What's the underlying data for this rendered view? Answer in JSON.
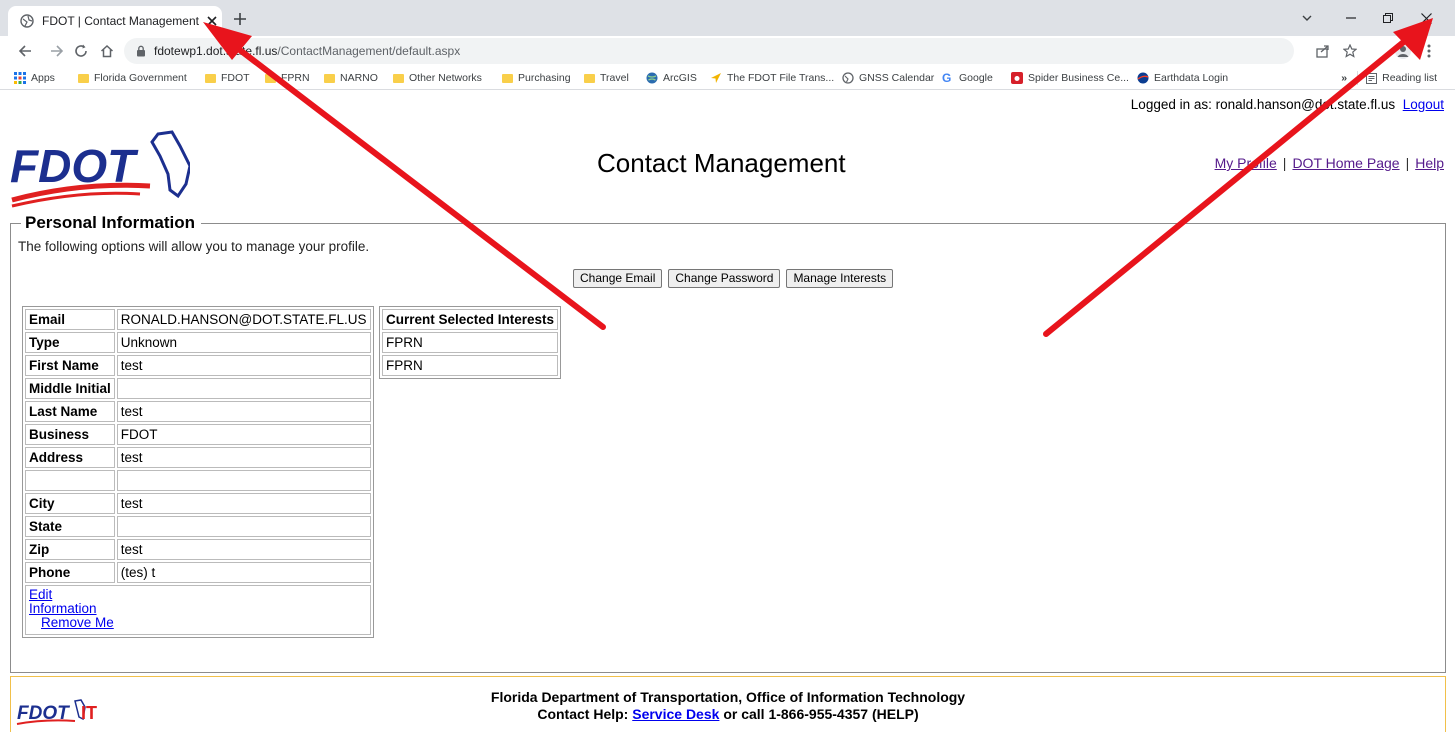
{
  "browser": {
    "tab_title": "FDOT | Contact Management | Ho",
    "url_host": "fdotewp1.dot.state.fl.us",
    "url_path": "/ContactManagement/default.aspx",
    "bookmarks": [
      {
        "label": "Apps",
        "icon": "apps-grid-icon"
      },
      {
        "label": "Florida Government",
        "icon": "folder-icon"
      },
      {
        "label": "FDOT",
        "icon": "folder-icon"
      },
      {
        "label": "FPRN",
        "icon": "folder-icon"
      },
      {
        "label": "NARNO",
        "icon": "folder-icon"
      },
      {
        "label": "Other Networks",
        "icon": "folder-icon"
      },
      {
        "label": "Purchasing",
        "icon": "folder-icon"
      },
      {
        "label": "Travel",
        "icon": "folder-icon"
      },
      {
        "label": "ArcGIS",
        "icon": "globe-icon"
      },
      {
        "label": "The FDOT File Trans...",
        "icon": "send-icon"
      },
      {
        "label": "GNSS Calendar",
        "icon": "globe-icon"
      },
      {
        "label": "Google",
        "icon": "google-icon"
      },
      {
        "label": "Spider Business Ce...",
        "icon": "spider-icon"
      },
      {
        "label": "Earthdata Login",
        "icon": "nasa-icon"
      }
    ],
    "reading_list": "Reading list"
  },
  "header": {
    "logged_in_text": "Logged in as: ronald.hanson@dot.state.fl.us",
    "logout": "Logout",
    "title": "Contact Management",
    "links": {
      "my_profile": "My Profile",
      "dot_home": "DOT Home Page",
      "help": "Help"
    },
    "separator": "|"
  },
  "personal": {
    "legend": "Personal Information",
    "intro": "The following options will allow you to manage your profile.",
    "buttons": {
      "change_email": "Change Email",
      "change_password": "Change Password",
      "manage_interests": "Manage Interests"
    },
    "labels": {
      "email": "Email",
      "type": "Type",
      "first_name": "First Name",
      "middle_initial": "Middle Initial",
      "last_name": "Last Name",
      "business": "Business",
      "address": "Address",
      "city": "City",
      "state": "State",
      "zip": "Zip",
      "phone": "Phone"
    },
    "values": {
      "email": "RONALD.HANSON@DOT.STATE.FL.US",
      "type": "Unknown",
      "first_name": "test",
      "middle_initial": "",
      "last_name": "test",
      "business": "FDOT",
      "address": "test",
      "address2": "",
      "city": "test",
      "state": "",
      "zip": "test",
      "phone": "(tes) t"
    },
    "edit_link_1": "Edit",
    "edit_link_2": "Information",
    "remove_link": "Remove Me"
  },
  "interests": {
    "header": "Current Selected Interests",
    "items": [
      "FPRN",
      "FPRN"
    ]
  },
  "footer": {
    "line1": "Florida Department of Transportation, Office of Information Technology",
    "line2_prefix": "Contact Help:",
    "service_desk": "Service Desk",
    "line2_suffix": "or call 1-866-955-4357 (HELP)"
  },
  "colors": {
    "fdot_blue": "#1c2f8f",
    "fdot_red": "#e02020",
    "annotation_red": "#e8141c"
  }
}
